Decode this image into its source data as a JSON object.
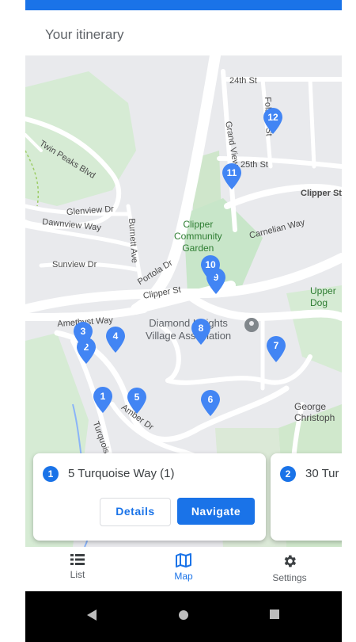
{
  "header": {
    "title": "Your itinerary"
  },
  "map": {
    "streets": [
      {
        "id": "24th",
        "text": "24th St"
      },
      {
        "id": "twin",
        "text": "Twin Peaks Blvd"
      },
      {
        "id": "grandview",
        "text": "Grand View"
      },
      {
        "id": "25th",
        "text": "25th St"
      },
      {
        "id": "clipper1",
        "text": "Clipper St"
      },
      {
        "id": "glenview",
        "text": "Glenview Dr"
      },
      {
        "id": "dawnview",
        "text": "Dawnview Way"
      },
      {
        "id": "burnett",
        "text": "Burnett Ave"
      },
      {
        "id": "carnelian",
        "text": "Carnelian Way"
      },
      {
        "id": "sunview",
        "text": "Sunview Dr"
      },
      {
        "id": "portola",
        "text": "Portola Dr"
      },
      {
        "id": "clipper2",
        "text": "Clipper St"
      },
      {
        "id": "amethyst",
        "text": "Amethyst Way"
      },
      {
        "id": "amber",
        "text": "Amber Dr"
      },
      {
        "id": "turquoise",
        "text": "Turquoise"
      },
      {
        "id": "folsom",
        "text": "Folsom St"
      }
    ],
    "places": {
      "garden": "Clipper\nCommunity\nGarden",
      "upper": "Upper\nDog",
      "diamond": "Diamond Heights\nVillage Association",
      "george": "George\nChristoph"
    },
    "pins": [
      "1",
      "2",
      "3",
      "4",
      "5",
      "6",
      "7",
      "8",
      "9",
      "10",
      "11",
      "12"
    ],
    "pin_color": "#4285f4"
  },
  "cards": [
    {
      "number": "1",
      "title": "5 Turquoise Way (1)",
      "details_label": "Details",
      "navigate_label": "Navigate"
    },
    {
      "number": "2",
      "title": "30 Tur"
    }
  ],
  "bottom_nav": [
    {
      "label": "List",
      "icon": "list-icon"
    },
    {
      "label": "Map",
      "icon": "map-icon",
      "active": true
    },
    {
      "label": "Settings",
      "icon": "gear-icon"
    }
  ],
  "system_nav": [
    "back-icon",
    "home-icon",
    "recents-icon"
  ],
  "colors": {
    "accent": "#1a73e8",
    "park": "#c8e6c9",
    "road": "#ffffff",
    "land": "#e9eaed"
  }
}
